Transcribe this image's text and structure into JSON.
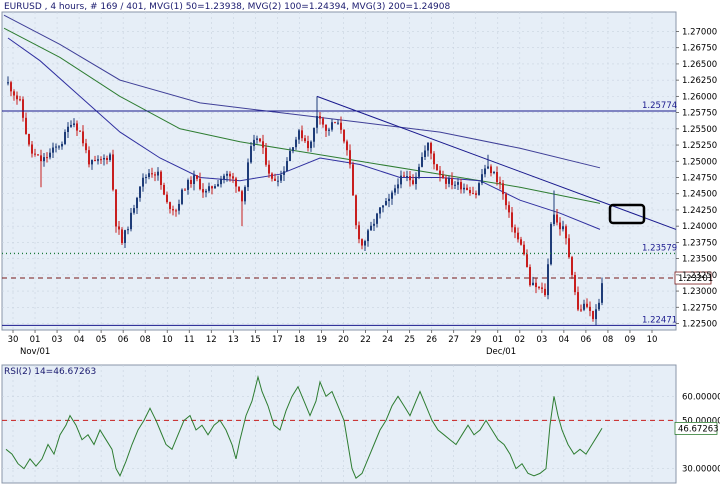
{
  "header": {
    "symbol_text": "EURUSD , 4 hours, # 169 / 401, MVG(1) 50=1.23938, MVG(2) 100=1.24394, MVG(3) 200=1.24908"
  },
  "rsi_header": {
    "text": "RSI(2) 14=46.67263"
  },
  "colors": {
    "background": "#ffffff",
    "chart_bg": "#e6eef7",
    "grid": "#c9d3e0",
    "up_candle": "#1e3c78",
    "down_candle": "#c81e1e",
    "ma50": "#3030a0",
    "ma100": "#2e7d32",
    "ma200": "#404098",
    "resistance": "#1a1a8e",
    "dotted_support": "#1b7a3a",
    "dashed_current": "#7a1a1a",
    "rsi_line": "#2e7d32",
    "rsi_mid": "#c81e1e"
  },
  "chart_data": [
    {
      "type": "candlestick",
      "title": "EURUSD , 4 hours",
      "x_tick_labels": [
        "30",
        "01",
        "03",
        "04",
        "05",
        "06",
        "08",
        "10",
        "11",
        "12",
        "13",
        "15",
        "17",
        "18",
        "19",
        "20",
        "22",
        "24",
        "25",
        "26",
        "27",
        "29",
        "01",
        "02",
        "03",
        "04",
        "06",
        "08",
        "09",
        "10"
      ],
      "x_month_labels": [
        "Nov/01",
        "Dec/01"
      ],
      "y_tick_labels": [
        "1.27000",
        "1.26750",
        "1.26500",
        "1.26250",
        "1.26000",
        "1.25750",
        "1.25500",
        "1.25250",
        "1.25000",
        "1.24750",
        "1.24500",
        "1.24250",
        "1.24000",
        "1.23750",
        "1.23500",
        "1.23250",
        "1.23000",
        "1.22750",
        "1.22500"
      ],
      "ylim": [
        1.224,
        1.273
      ],
      "levels": {
        "resistance": "1.25774",
        "support_dotted": "1.23579",
        "current_price": "1.23201",
        "low_line": "1.22471"
      },
      "moving_averages": [
        {
          "name": "MVG(1) 50",
          "value": 1.23938
        },
        {
          "name": "MVG(2) 100",
          "value": 1.24394
        },
        {
          "name": "MVG(3) 200",
          "value": 1.24908
        }
      ],
      "grid": true
    },
    {
      "type": "line",
      "title": "RSI(2) 14=46.67263",
      "y_tick_labels": [
        "60.00000",
        "50.00000",
        "46.67263",
        "30.00000"
      ],
      "ylim": [
        24,
        73
      ],
      "reference_levels": [
        50
      ],
      "last_value": 46.67263,
      "grid": true
    }
  ]
}
